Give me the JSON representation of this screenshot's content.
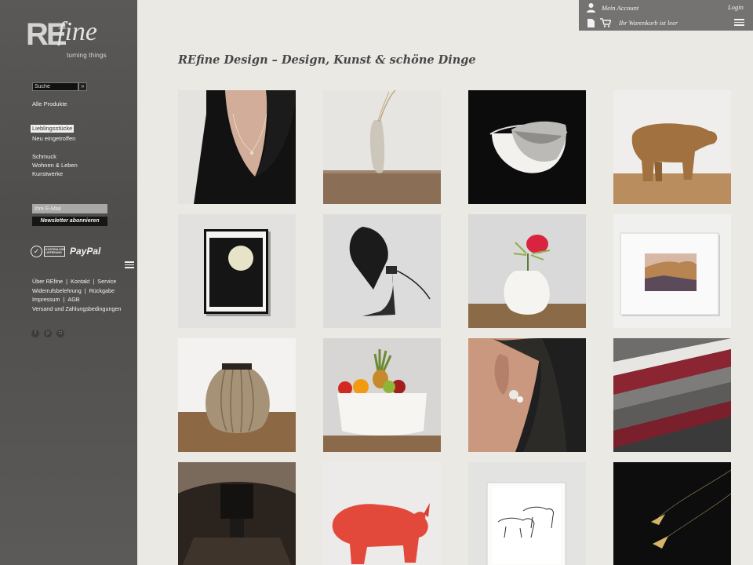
{
  "logo": {
    "re": "RE",
    "fine": "fine",
    "tagline": "turning things"
  },
  "search": {
    "placeholder": "Suche",
    "button": "»"
  },
  "nav": {
    "all_products": "Alle Produkte",
    "favorites": "Lieblingsstücke",
    "new_arrivals": "Neu eingetroffen",
    "jewelry": "Schmuck",
    "living": "Wohnen & Leben",
    "artworks": "Kunstwerke"
  },
  "newsletter": {
    "placeholder": "Ihre E-Mail",
    "button": "Newsletter abonnieren"
  },
  "badges": {
    "delivery": "KOSTENLOSE LIEFERUNG",
    "paypal": "PayPal"
  },
  "footer": {
    "about": "Über REfine",
    "contact": "Kontakt",
    "service": "Service",
    "withdrawal": "Widerrufsbelehrung",
    "returns": "Rückgabe",
    "imprint": "Impressum",
    "terms": "AGB",
    "shipping": "Versand und Zahlungsbedingungen"
  },
  "socials": [
    "facebook-icon",
    "pinterest-icon",
    "instagram-icon"
  ],
  "topbar": {
    "account": "Mein Account",
    "login": "Login",
    "cart": "Ihr Warenkorb ist leer"
  },
  "heading": "REfine Design – Design, Kunst & schöne Dinge",
  "products": [
    "necklace-on-model",
    "glass-vase-with-grass",
    "ceramic-bowls",
    "wooden-bear-sculpture",
    "framed-moon-print",
    "black-lamp",
    "white-vase-with-flower",
    "framed-landscape-print",
    "ribbed-brass-vase",
    "fruit-bowl",
    "earring-on-model",
    "knitted-striped-blanket",
    "table-lamp",
    "red-felt-rhino",
    "framed-animal-drawing",
    "gold-pendant-necklace"
  ],
  "colors": {
    "sidebar": "#545351",
    "topbar": "#747371",
    "background": "#ebe9e4"
  }
}
